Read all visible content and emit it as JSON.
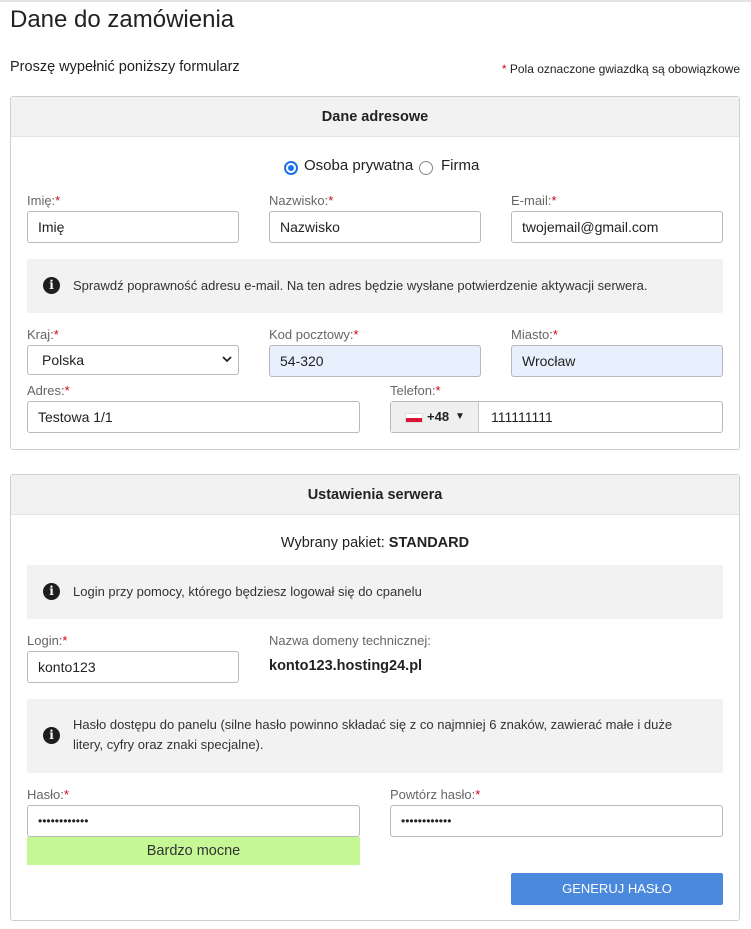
{
  "page": {
    "title": "Dane do zamówienia",
    "subtitle": "Proszę wypełnić poniższy formularz",
    "required_note": "Pola oznaczone gwiazdką są obowiązkowe",
    "required_star": "*"
  },
  "address": {
    "header": "Dane adresowe",
    "radio_private": "Osoba prywatna",
    "radio_company": "Firma",
    "selected_type": "Osoba prywatna",
    "first_name": {
      "label": "Imię:",
      "placeholder": "Imię",
      "value": ""
    },
    "last_name": {
      "label": "Nazwisko:",
      "placeholder": "Nazwisko",
      "value": ""
    },
    "email": {
      "label": "E-mail:",
      "value": "twojemail@gmail.com"
    },
    "email_info": "Sprawdź poprawność adresu e-mail. Na ten adres będzie wysłane potwierdzenie aktywacji serwera.",
    "country": {
      "label": "Kraj:",
      "value": "Polska"
    },
    "zip": {
      "label": "Kod pocztowy:",
      "value": "54-320"
    },
    "city": {
      "label": "Miasto:",
      "value": "Wrocław"
    },
    "street": {
      "label": "Adres:",
      "value": "Testowa 1/1"
    },
    "phone": {
      "label": "Telefon:",
      "prefix": "+48",
      "caret": "▼",
      "value": "111111111"
    }
  },
  "server": {
    "header": "Ustawienia serwera",
    "package_label": "Wybrany pakiet:",
    "package_value": "STANDARD",
    "login_info": "Login przy pomocy, którego będziesz logował się do cpanelu",
    "login": {
      "label": "Login:",
      "value": "konto123"
    },
    "domain": {
      "label": "Nazwa domeny technicznej:",
      "value": "konto123.hosting24.pl"
    },
    "password_info": "Hasło dostępu do panelu (silne hasło powinno składać się z co najmniej 6 znaków, zawierać małe i duże litery, cyfry oraz znaki specjalne).",
    "password": {
      "label": "Hasło:",
      "value": "••••••••••••"
    },
    "password_repeat": {
      "label": "Powtórz hasło:",
      "value": "••••••••••••"
    },
    "strength": "Bardzo mocne",
    "generate_button": "GENERUJ HASŁO"
  },
  "icons": {
    "info": "i",
    "info_icon_name": "info-circle-icon",
    "chevron_name": "chevron-down-icon",
    "flag_name": "poland-flag-icon"
  },
  "colors": {
    "required": "#d0021b",
    "radio_selected": "#1a73e8",
    "button": "#4a89dc",
    "strength_bg": "#c5f895",
    "autofill_bg": "#e8f0fe"
  }
}
